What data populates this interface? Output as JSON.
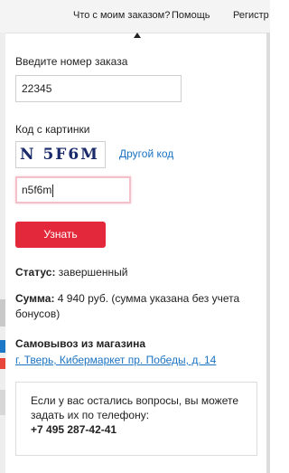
{
  "topnav": {
    "order_status": "Что с моим заказом?",
    "help": "Помощь",
    "register": "Регистр"
  },
  "form": {
    "order_label": "Введите номер заказа",
    "order_value": "22345",
    "captcha_label": "Код с картинки",
    "captcha_image_text": "N 5F6M",
    "captcha_refresh": "Другой код",
    "captcha_value": "n5f6m",
    "submit": "Узнать"
  },
  "result": {
    "status_label": "Статус:",
    "status_value": "завершенный",
    "sum_label": "Сумма:",
    "sum_value": "4 940 руб. (сумма указана без учета бонусов)",
    "pickup_title": "Самовывоз из магазина",
    "pickup_address": "г. Тверь, Кибермаркет пр. Победы, д. 14"
  },
  "contact": {
    "text": "Если у вас остались вопросы, вы можете задать их по телефону:",
    "phone": "+7 495 287-42-41"
  },
  "colors": {
    "accent_button": "#e3283b",
    "link": "#1b73c2",
    "focus_border": "#f3c0c9"
  }
}
